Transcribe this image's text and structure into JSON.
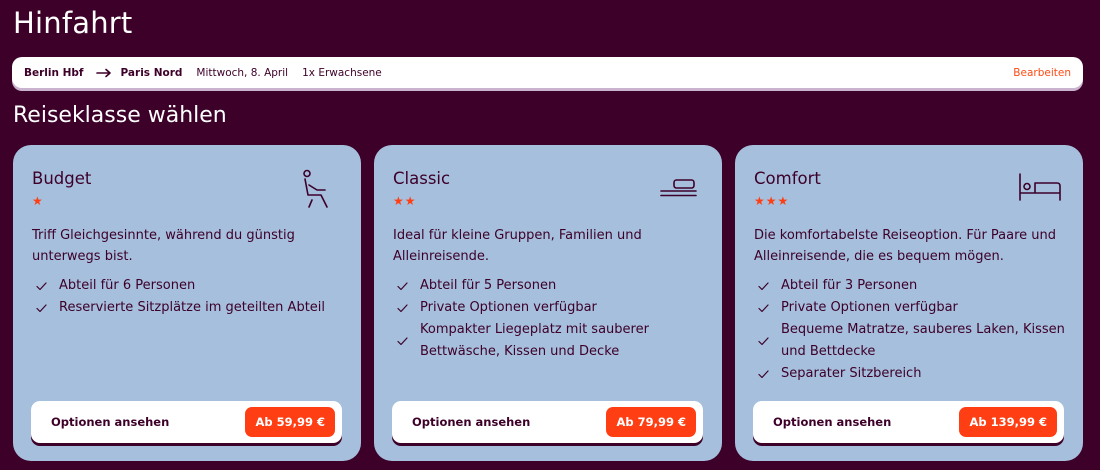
{
  "page_title": "Hinfahrt",
  "trip": {
    "from": "Berlin Hbf",
    "to": "Paris Nord",
    "date": "Mittwoch, 8. April",
    "passengers": "1x Erwachsene",
    "edit_label": "Bearbeiten"
  },
  "section_title": "Reiseklasse wählen",
  "colors": {
    "background": "#3d0029",
    "card": "#a5bfdc",
    "accent": "#ff3e14",
    "link": "#ff4a14"
  },
  "cards": [
    {
      "title": "Budget",
      "stars": "★",
      "icon": "seat-icon",
      "description": "Triff Gleichgesinnte, während du günstig unterwegs bist.",
      "features": [
        "Abteil für 6 Personen",
        "Reservierte Sitzplätze im geteilten Abteil"
      ],
      "cta_label": "Optionen ansehen",
      "price": "Ab 59,99 €"
    },
    {
      "title": "Classic",
      "stars": "★★",
      "icon": "couchette-icon",
      "description": "Ideal für kleine Gruppen, Familien und Alleinreisende.",
      "features": [
        "Abteil für 5 Personen",
        "Private Optionen verfügbar",
        "Kompakter Liegeplatz mit sauberer Bettwäsche, Kissen und Decke"
      ],
      "cta_label": "Optionen ansehen",
      "price": "Ab 79,99 €"
    },
    {
      "title": "Comfort",
      "stars": "★★★",
      "icon": "bed-icon",
      "description": "Die komfortabelste Reiseoption. Für Paare und Alleinreisende, die es bequem mögen.",
      "features": [
        "Abteil für 3 Personen",
        "Private Optionen verfügbar",
        "Bequeme Matratze, sauberes Laken, Kissen und Bettdecke",
        "Separater Sitzbereich"
      ],
      "cta_label": "Optionen ansehen",
      "price": "Ab 139,99 €"
    }
  ]
}
